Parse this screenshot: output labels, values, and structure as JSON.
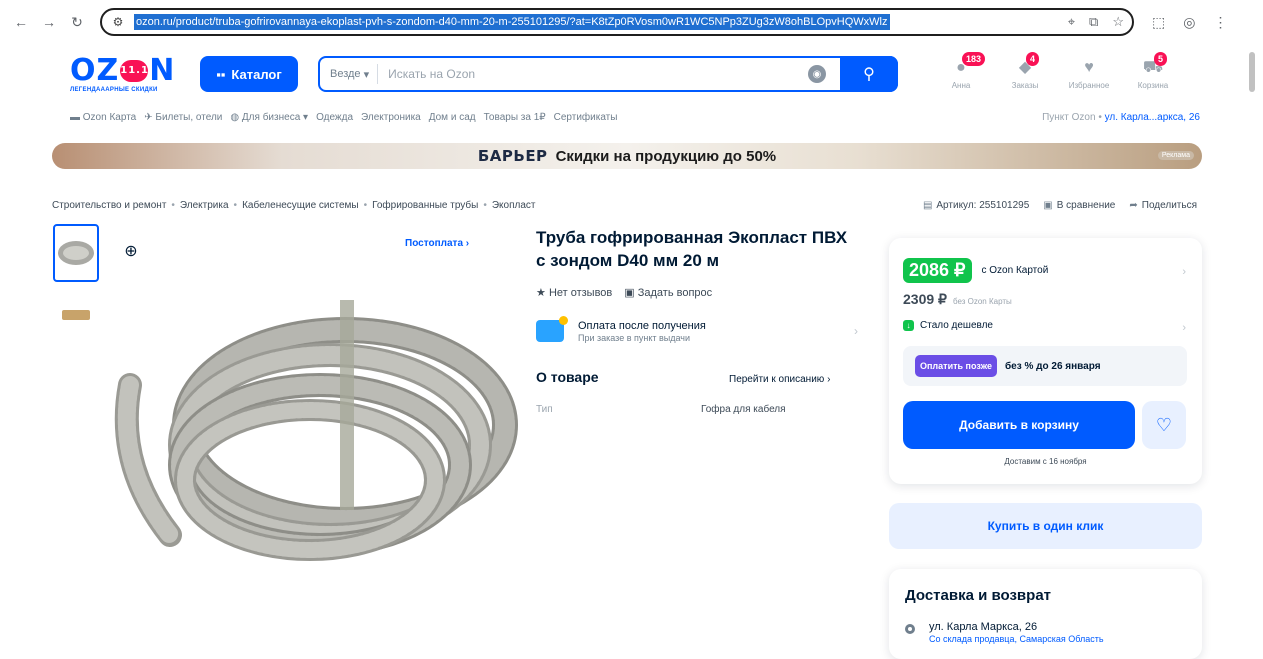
{
  "browser": {
    "url": "ozon.ru/product/truba-gofrirovannaya-ekoplast-pvh-s-zondom-d40-mm-20-m-255101295/?at=K8tZp0RVosm0wR1WC5NPp3ZUg3zW8ohBLOpvHQWxWlz"
  },
  "header": {
    "logo": "OZON",
    "logo_badge": "11.11",
    "logo_sub": "ЛЕГЕНДАААРНЫЕ СКИДКИ",
    "catalog_label": "Каталог",
    "search_scope": "Везде",
    "search_placeholder": "Искать на Ozon",
    "icons": [
      {
        "label": "Анна",
        "badge": "183"
      },
      {
        "label": "Заказы",
        "badge": "4"
      },
      {
        "label": "Избранное",
        "badge": ""
      },
      {
        "label": "Корзина",
        "badge": "5"
      }
    ]
  },
  "subnav": {
    "items": [
      "Ozon Карта",
      "Билеты, отели",
      "Для бизнеса",
      "Одежда",
      "Электроника",
      "Дом и сад",
      "Товары за 1₽",
      "Сертификаты"
    ],
    "pickup_label": "Пункт Ozon •",
    "pickup_address": "ул. Карла...аркса, 26"
  },
  "banner": {
    "brand": "БАРЬЕР",
    "text": "Скидки на продукцию до 50%",
    "tag": "Реклама"
  },
  "breadcrumbs": [
    "Строительство и ремонт",
    "Электрика",
    "Кабеленесущие системы",
    "Гофрированные трубы",
    "Экопласт"
  ],
  "tools": {
    "article": "Артикул: 255101295",
    "compare": "В сравнение",
    "share": "Поделиться"
  },
  "gallery": {
    "postpay": "Постоплата ›"
  },
  "product": {
    "title": "Труба гофрированная Экопласт ПВХ с зондом D40 мм 20 м",
    "reviews": "Нет отзывов",
    "ask": "Задать вопрос",
    "pay_after_title": "Оплата после получения",
    "pay_after_sub": "При заказе в пункт выдачи",
    "about_title": "О товаре",
    "about_link": "Перейти к описанию ›",
    "specs": [
      {
        "key": "Тип",
        "value": "Гофра для кабеля"
      }
    ]
  },
  "price": {
    "card_price": "2086 ₽",
    "card_note": "c Ozon Картой",
    "price": "2309 ₽",
    "price_note": "без Ozon Карты",
    "cheaper": "Стало дешевле",
    "later_btn": "Оплатить позже",
    "later_text": "без % до 26 января",
    "add_to_cart": "Добавить в корзину",
    "delivery_note": "Доставим с 16 ноября",
    "one_click": "Купить в один клик"
  },
  "delivery": {
    "title": "Доставка и возврат",
    "address": "ул. Карла Маркса, 26",
    "address_sub": "Со склада продавца, Самарская Область"
  },
  "colors": {
    "accent": "#005bff",
    "price_green": "#10c44c",
    "badge": "#f91155"
  }
}
